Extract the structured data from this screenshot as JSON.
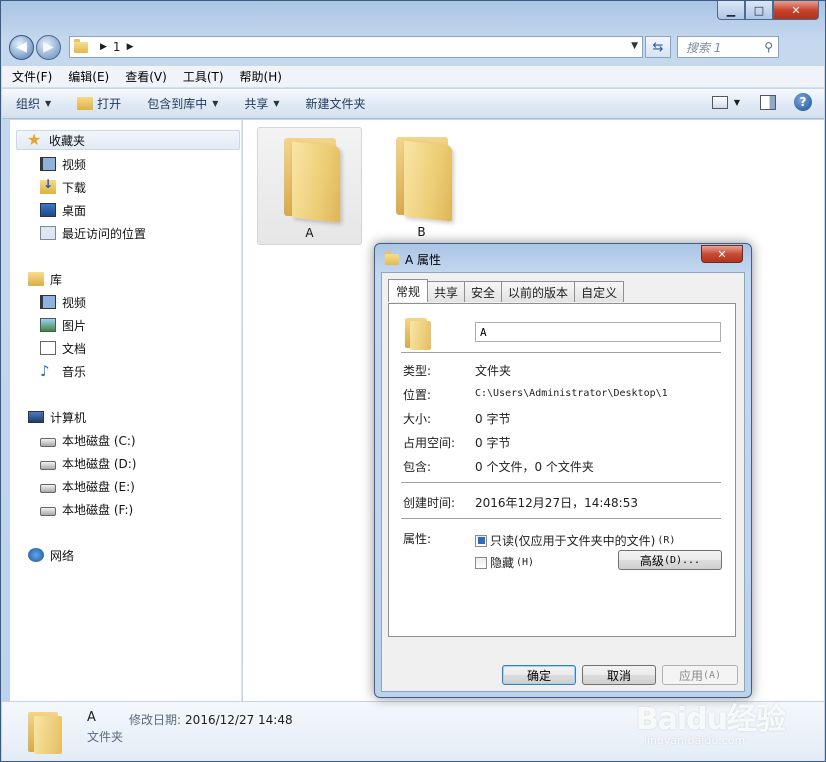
{
  "address": {
    "crumb": "1"
  },
  "search": {
    "placeholder": "搜索 1"
  },
  "menubar": {
    "items": [
      "文件(F)",
      "编辑(E)",
      "查看(V)",
      "工具(T)",
      "帮助(H)"
    ]
  },
  "cmdbar": {
    "organize": "组织",
    "open": "打开",
    "include_library": "包含到库中",
    "share": "共享",
    "new_folder": "新建文件夹"
  },
  "navpane": {
    "favorites": {
      "label": "收藏夹",
      "items": [
        "视频",
        "下载",
        "桌面",
        "最近访问的位置"
      ]
    },
    "libraries": {
      "label": "库",
      "items": [
        "视频",
        "图片",
        "文档",
        "音乐"
      ]
    },
    "computer": {
      "label": "计算机",
      "items": [
        "本地磁盘 (C:)",
        "本地磁盘 (D:)",
        "本地磁盘 (E:)",
        "本地磁盘 (F:)"
      ]
    },
    "network": {
      "label": "网络"
    }
  },
  "content": {
    "folders": [
      {
        "name": "A",
        "selected": true
      },
      {
        "name": "B",
        "selected": false
      }
    ]
  },
  "details": {
    "name": "A",
    "type": "文件夹",
    "modified_label": "修改日期:",
    "modified_value": "2016/12/27 14:48"
  },
  "dialog": {
    "title": "A 属性",
    "tabs": [
      "常规",
      "共享",
      "安全",
      "以前的版本",
      "自定义"
    ],
    "active_tab": "常规",
    "name_value": "A",
    "props": {
      "type_label": "类型:",
      "type_value": "文件夹",
      "location_label": "位置:",
      "location_value": "C:\\Users\\Administrator\\Desktop\\1",
      "size_label": "大小:",
      "size_value": "0 字节",
      "disk_label": "占用空间:",
      "disk_value": "0 字节",
      "contains_label": "包含:",
      "contains_value": "0 个文件，0 个文件夹",
      "created_label": "创建时间:",
      "created_value": "2016年12月27日，14:48:53",
      "attr_label": "属性:"
    },
    "readonly_label": "只读(仅应用于文件夹中的文件)",
    "readonly_key": "(R)",
    "hidden_label": "隐藏",
    "hidden_key": "(H)",
    "advanced_label": "高级",
    "advanced_key": "(D)...",
    "ok_label": "确定",
    "cancel_label": "取消",
    "apply_label": "应用",
    "apply_key": "(A)"
  },
  "watermark": {
    "main": "Baidu经验",
    "sub": "jingyan.baidu.com"
  }
}
